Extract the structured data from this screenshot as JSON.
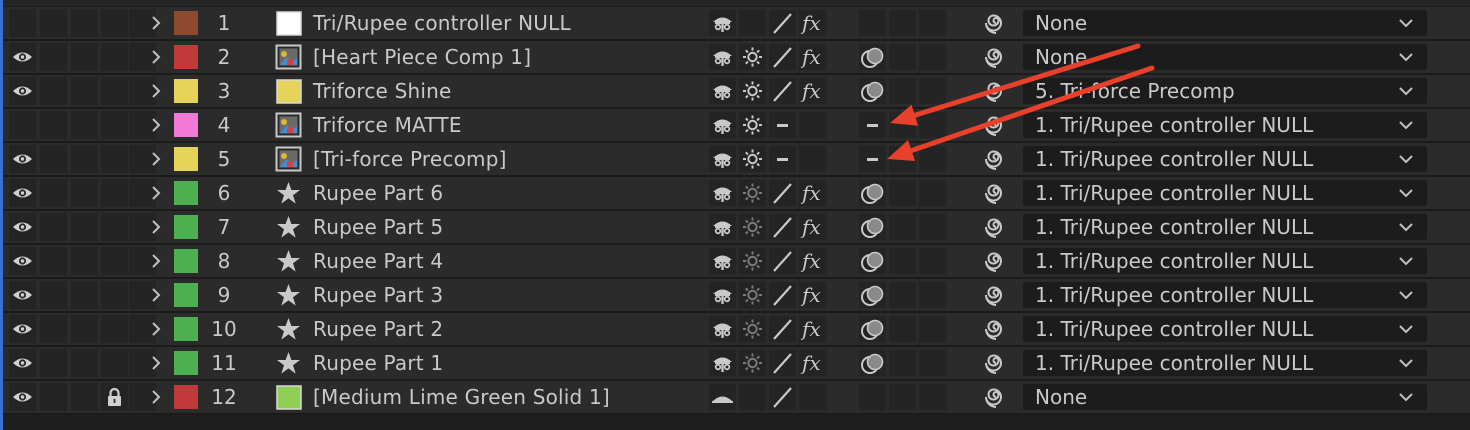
{
  "colors": {
    "accent_left": "#3a6fd8",
    "annotation_arrow": "#e8402a",
    "icon_color": "#c9c9c9"
  },
  "layers": [
    {
      "num": "1",
      "name": "Tri/Rupee controller NULL",
      "label_color": "#8c4a2f",
      "eye": false,
      "lock": false,
      "source": "null-white",
      "sw": {
        "shy": true,
        "collapse": false,
        "quality": "slash",
        "fx": true,
        "mb": "none"
      },
      "parent": "None",
      "parent_clipped": false
    },
    {
      "num": "2",
      "name": "[Heart Piece Comp 1]",
      "label_color": "#c03a3a",
      "eye": true,
      "lock": false,
      "source": "comp",
      "sw": {
        "shy": true,
        "collapse": "on",
        "quality": "slash",
        "fx": true,
        "mb": "on"
      },
      "parent": "None",
      "parent_clipped": false
    },
    {
      "num": "3",
      "name": "Triforce Shine",
      "label_color": "#e6d45a",
      "eye": true,
      "lock": false,
      "source": "yellow-solid",
      "sw": {
        "shy": true,
        "collapse": "on",
        "quality": "slash",
        "fx": true,
        "mb": "on"
      },
      "parent": "5. Tri-force Precomp",
      "parent_clipped": true
    },
    {
      "num": "4",
      "name": "Triforce MATTE",
      "label_color": "#f07ad6",
      "eye": false,
      "lock": false,
      "source": "comp",
      "sw": {
        "shy": true,
        "collapse": "on",
        "quality": "dash",
        "fx": false,
        "mb": "dash"
      },
      "parent": "1. Tri/Rupee controller NULL",
      "parent_clipped": false
    },
    {
      "num": "5",
      "name": "[Tri-force Precomp]",
      "label_color": "#e6d45a",
      "eye": true,
      "lock": false,
      "source": "comp",
      "sw": {
        "shy": true,
        "collapse": "on",
        "quality": "dash",
        "fx": false,
        "mb": "dash"
      },
      "parent": "1. Tri/Rupee controller NULL",
      "parent_clipped": false
    },
    {
      "num": "6",
      "name": "Rupee Part 6",
      "label_color": "#4caf50",
      "eye": true,
      "lock": false,
      "source": "star",
      "sw": {
        "shy": true,
        "collapse": "dim",
        "quality": "slash",
        "fx": true,
        "mb": "on"
      },
      "parent": "1. Tri/Rupee controller NULL",
      "parent_clipped": false
    },
    {
      "num": "7",
      "name": "Rupee Part 5",
      "label_color": "#4caf50",
      "eye": true,
      "lock": false,
      "source": "star",
      "sw": {
        "shy": true,
        "collapse": "dim",
        "quality": "slash",
        "fx": true,
        "mb": "on"
      },
      "parent": "1. Tri/Rupee controller NULL",
      "parent_clipped": false
    },
    {
      "num": "8",
      "name": "Rupee Part 4",
      "label_color": "#4caf50",
      "eye": true,
      "lock": false,
      "source": "star",
      "sw": {
        "shy": true,
        "collapse": "dim",
        "quality": "slash",
        "fx": true,
        "mb": "on"
      },
      "parent": "1. Tri/Rupee controller NULL",
      "parent_clipped": false
    },
    {
      "num": "9",
      "name": "Rupee Part 3",
      "label_color": "#4caf50",
      "eye": true,
      "lock": false,
      "source": "star",
      "sw": {
        "shy": true,
        "collapse": "dim",
        "quality": "slash",
        "fx": true,
        "mb": "on"
      },
      "parent": "1. Tri/Rupee controller NULL",
      "parent_clipped": false
    },
    {
      "num": "10",
      "name": "Rupee Part 2",
      "label_color": "#4caf50",
      "eye": true,
      "lock": false,
      "source": "star",
      "sw": {
        "shy": true,
        "collapse": "dim",
        "quality": "slash",
        "fx": true,
        "mb": "on"
      },
      "parent": "1. Tri/Rupee controller NULL",
      "parent_clipped": false
    },
    {
      "num": "11",
      "name": "Rupee Part 1",
      "label_color": "#4caf50",
      "eye": true,
      "lock": false,
      "source": "star",
      "sw": {
        "shy": true,
        "collapse": "dim",
        "quality": "slash",
        "fx": true,
        "mb": "on"
      },
      "parent": "1. Tri/Rupee controller NULL",
      "parent_clipped": false
    },
    {
      "num": "12",
      "name": "[Medium Lime Green Solid 1]",
      "label_color": "#c03a3a",
      "eye": true,
      "lock": true,
      "source": "lime-solid",
      "sw": {
        "shy": "solid",
        "collapse": false,
        "quality": "slash",
        "fx": false,
        "mb": "none"
      },
      "parent": "None",
      "parent_clipped": false
    }
  ]
}
